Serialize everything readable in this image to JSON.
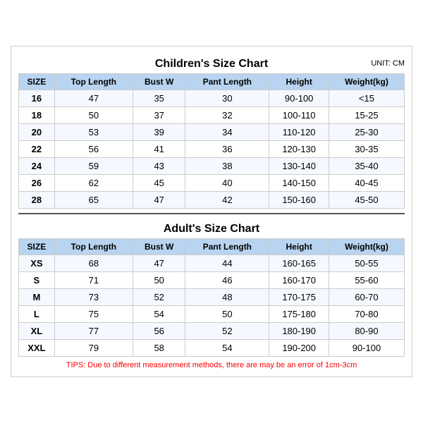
{
  "children_title": "Children's Size Chart",
  "adult_title": "Adult's Size Chart",
  "unit_label": "UNIT: CM",
  "headers": [
    "SIZE",
    "Top Length",
    "Bust W",
    "Pant Length",
    "Height",
    "Weight(kg)"
  ],
  "children_rows": [
    [
      "16",
      "47",
      "35",
      "30",
      "90-100",
      "<15"
    ],
    [
      "18",
      "50",
      "37",
      "32",
      "100-110",
      "15-25"
    ],
    [
      "20",
      "53",
      "39",
      "34",
      "110-120",
      "25-30"
    ],
    [
      "22",
      "56",
      "41",
      "36",
      "120-130",
      "30-35"
    ],
    [
      "24",
      "59",
      "43",
      "38",
      "130-140",
      "35-40"
    ],
    [
      "26",
      "62",
      "45",
      "40",
      "140-150",
      "40-45"
    ],
    [
      "28",
      "65",
      "47",
      "42",
      "150-160",
      "45-50"
    ]
  ],
  "adult_rows": [
    [
      "XS",
      "68",
      "47",
      "44",
      "160-165",
      "50-55"
    ],
    [
      "S",
      "71",
      "50",
      "46",
      "160-170",
      "55-60"
    ],
    [
      "M",
      "73",
      "52",
      "48",
      "170-175",
      "60-70"
    ],
    [
      "L",
      "75",
      "54",
      "50",
      "175-180",
      "70-80"
    ],
    [
      "XL",
      "77",
      "56",
      "52",
      "180-190",
      "80-90"
    ],
    [
      "XXL",
      "79",
      "58",
      "54",
      "190-200",
      "90-100"
    ]
  ],
  "tips": "TIPS: Due to different measurement methods, there are may be an error of 1cm-3cm"
}
